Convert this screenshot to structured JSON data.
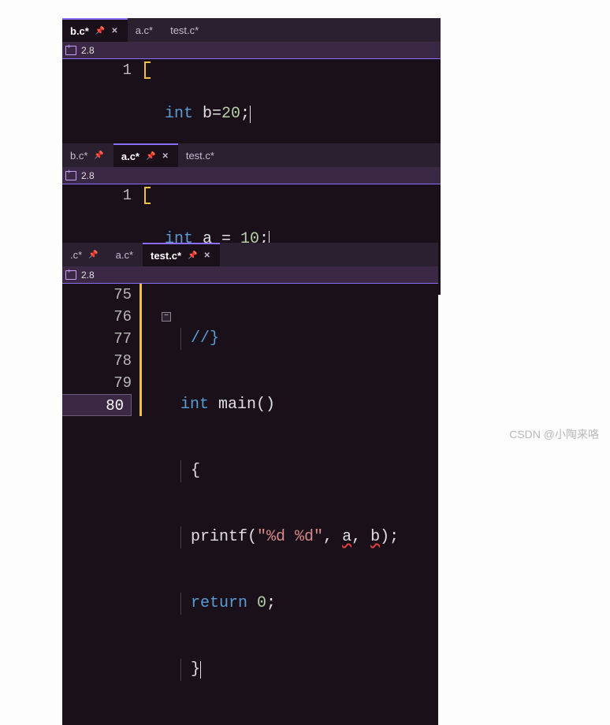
{
  "panels": [
    {
      "tabs": [
        {
          "label": "b.c*",
          "active": true,
          "pinned": true,
          "closeable": true
        },
        {
          "label": "a.c*",
          "active": false,
          "pinned": false,
          "closeable": false
        },
        {
          "label": "test.c*",
          "active": false,
          "pinned": false,
          "closeable": false
        }
      ],
      "zoom": "2.8",
      "lines": [
        {
          "num": "1",
          "tokens": [
            {
              "t": "int",
              "c": "kw"
            },
            {
              "t": " b=",
              "c": "var"
            },
            {
              "t": "20",
              "c": "num"
            },
            {
              "t": ";",
              "c": "punct"
            }
          ]
        }
      ]
    },
    {
      "tabs": [
        {
          "label": "b.c*",
          "active": false,
          "pinned": true,
          "closeable": false
        },
        {
          "label": "a.c*",
          "active": true,
          "pinned": true,
          "closeable": true
        },
        {
          "label": "test.c*",
          "active": false,
          "pinned": false,
          "closeable": false
        }
      ],
      "zoom": "2.8",
      "lines": [
        {
          "num": "1",
          "tokens": [
            {
              "t": "int",
              "c": "kw"
            },
            {
              "t": " a = ",
              "c": "var"
            },
            {
              "t": "10",
              "c": "num"
            },
            {
              "t": ";",
              "c": "punct"
            }
          ]
        }
      ]
    },
    {
      "tabs": [
        {
          "label": ".c*",
          "active": false,
          "pinned": true,
          "closeable": false
        },
        {
          "label": "a.c*",
          "active": false,
          "pinned": false,
          "closeable": false
        },
        {
          "label": "test.c*",
          "active": true,
          "pinned": true,
          "closeable": true
        }
      ],
      "zoom": "2.8",
      "lines": [
        {
          "num": "75",
          "tokens": [
            {
              "t": "//}",
              "c": "kw"
            }
          ]
        },
        {
          "num": "76",
          "fold": true,
          "tokens": [
            {
              "t": "int",
              "c": "kw"
            },
            {
              "t": " main",
              "c": "func"
            },
            {
              "t": "()",
              "c": "punct"
            }
          ]
        },
        {
          "num": "77",
          "tokens": [
            {
              "t": "{",
              "c": "punct"
            }
          ]
        },
        {
          "num": "78",
          "indent": true,
          "tokens": [
            {
              "t": "printf",
              "c": "func"
            },
            {
              "t": "(",
              "c": "punct"
            },
            {
              "t": "\"%d %d\"",
              "c": "str"
            },
            {
              "t": ", ",
              "c": "punct"
            },
            {
              "t": "a",
              "c": "var",
              "err": true
            },
            {
              "t": ", ",
              "c": "punct"
            },
            {
              "t": "b",
              "c": "var",
              "err": true
            },
            {
              "t": ");",
              "c": "punct"
            }
          ]
        },
        {
          "num": "79",
          "indent": true,
          "tokens": [
            {
              "t": "return",
              "c": "kw"
            },
            {
              "t": " ",
              "c": "var"
            },
            {
              "t": "0",
              "c": "num"
            },
            {
              "t": ";",
              "c": "punct"
            }
          ]
        },
        {
          "num": "80",
          "current": true,
          "tokens": [
            {
              "t": "}",
              "c": "punct"
            }
          ]
        }
      ]
    }
  ],
  "watermark": "CSDN @小陶来咯"
}
